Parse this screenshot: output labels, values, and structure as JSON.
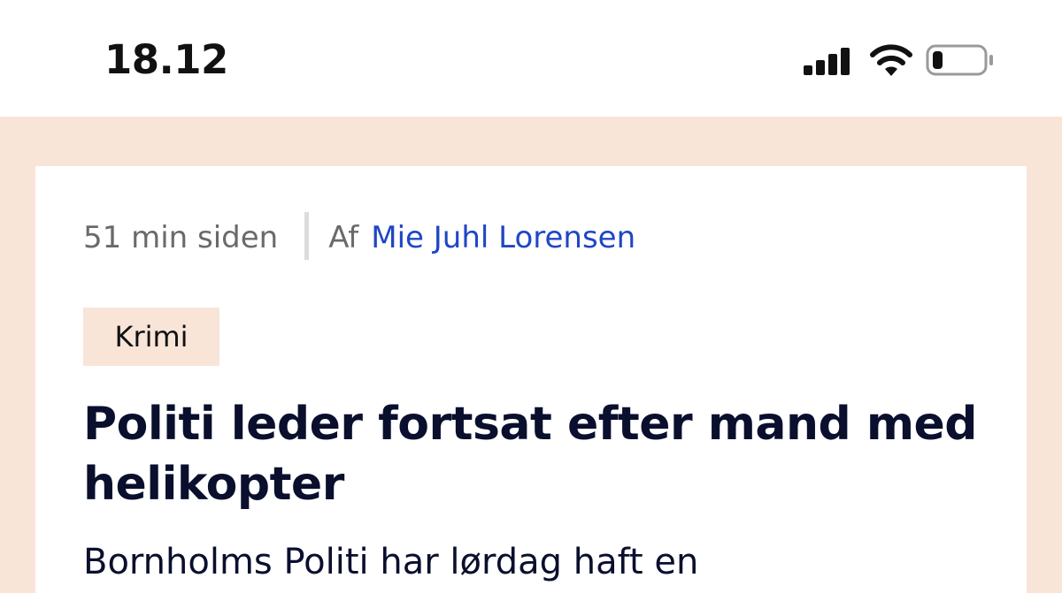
{
  "status_bar": {
    "time": "18.12",
    "icons": [
      "cellular-signal-icon",
      "wifi-icon",
      "battery-icon"
    ],
    "signal_bars": 4,
    "battery_level": 0.2
  },
  "article": {
    "published_ago": "51 min siden",
    "byline_prefix": "Af",
    "author": "Mie Juhl Lorensen",
    "category": "Krimi",
    "headline": "Politi leder fortsat efter mand med helikopter",
    "lede": "Bornholms Politi har lørdag haft en"
  },
  "colors": {
    "page_background": "#f9e4d8",
    "tag_background": "#f9e4d8",
    "author_link": "#1f47c4",
    "headline": "#0a0f2e",
    "meta_text": "#6a6a6a"
  }
}
